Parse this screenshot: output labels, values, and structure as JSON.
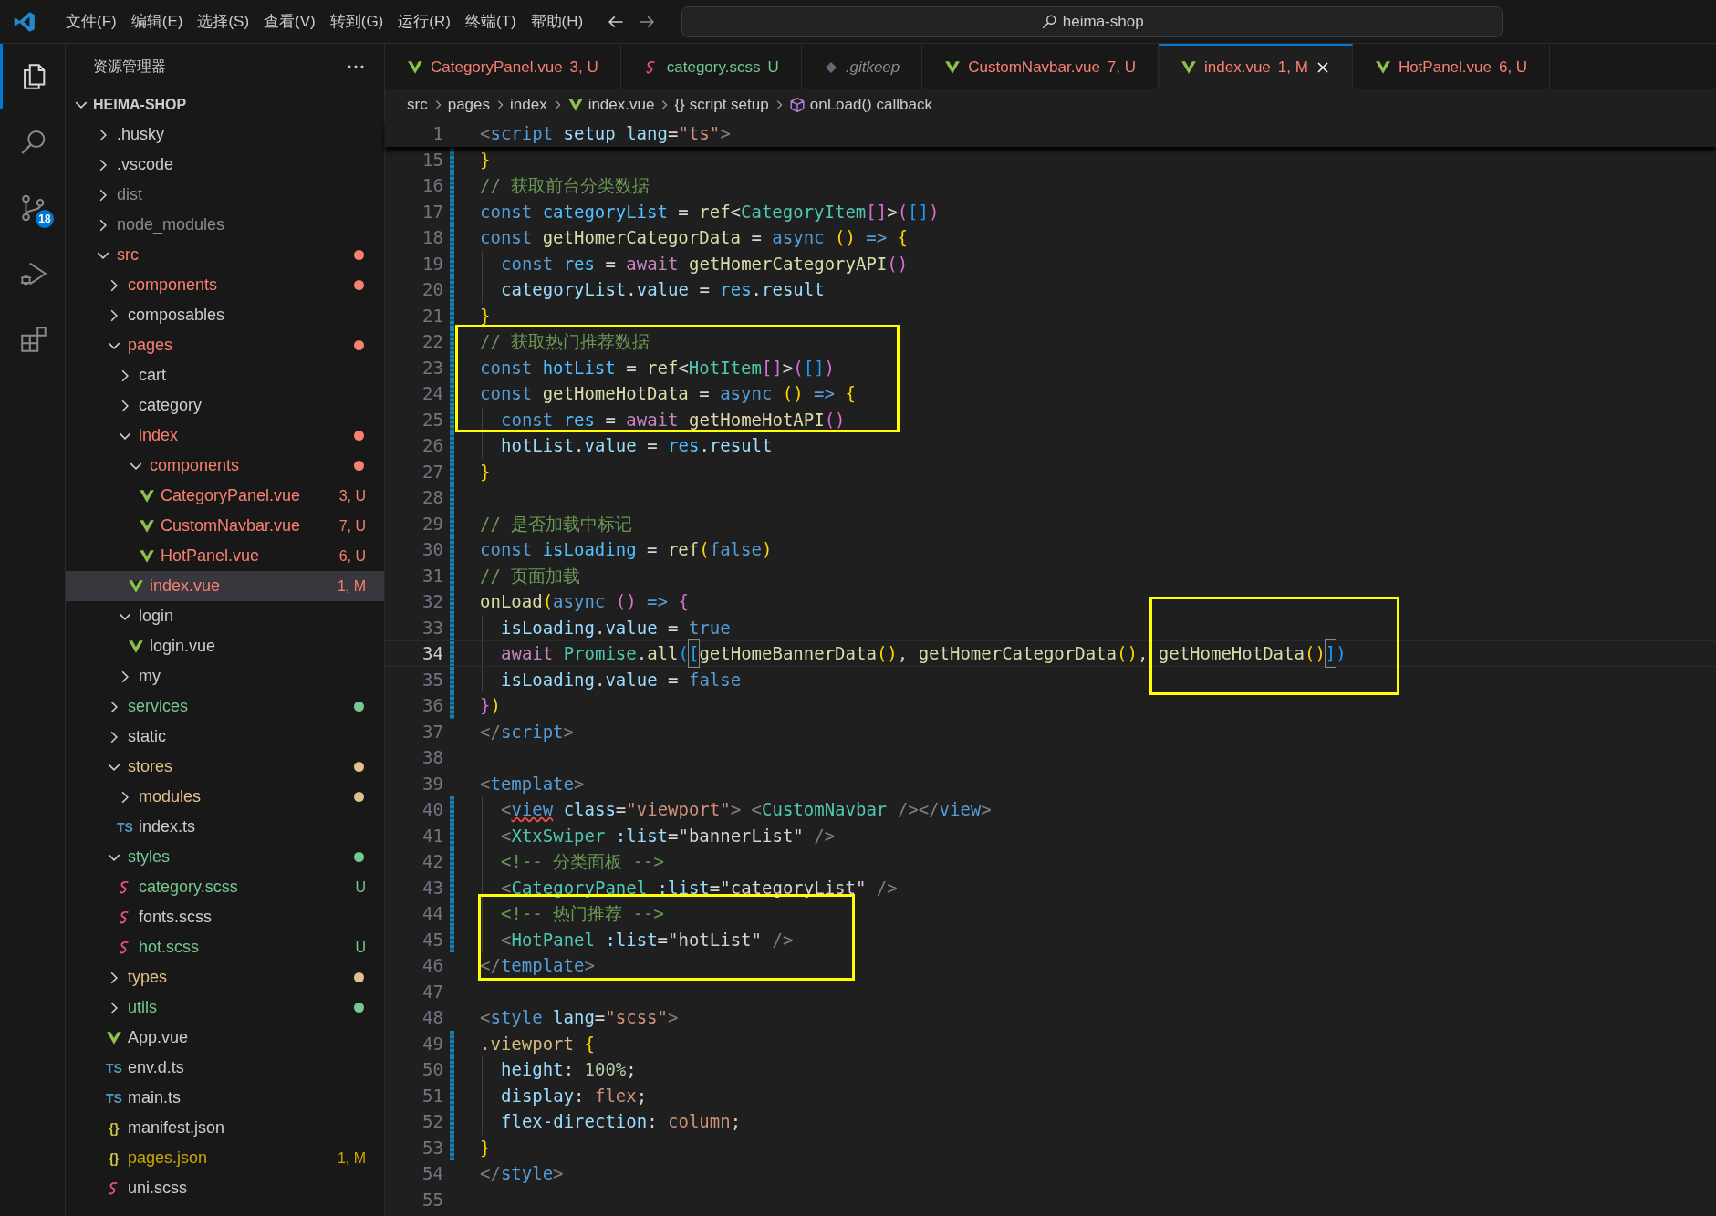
{
  "menu": [
    "文件(F)",
    "编辑(E)",
    "选择(S)",
    "查看(V)",
    "转到(G)",
    "运行(R)",
    "终端(T)",
    "帮助(H)"
  ],
  "command_center": {
    "text": "heima-shop"
  },
  "activity_bar": [
    {
      "kind": "files",
      "selected": true
    },
    {
      "kind": "search",
      "selected": false
    },
    {
      "kind": "source-control",
      "selected": false,
      "badge": "18"
    },
    {
      "kind": "run",
      "selected": false
    },
    {
      "kind": "extensions",
      "selected": false
    }
  ],
  "explorer": {
    "title": "资源管理器",
    "root": {
      "label": "HEIMA-SHOP",
      "expanded": true
    },
    "tree": [
      {
        "label": ".husky",
        "kind": "folder",
        "expanded": false,
        "color": "#cccccc",
        "dot": false,
        "selected": false
      },
      {
        "label": ".vscode",
        "kind": "folder",
        "expanded": false,
        "color": "#cccccc",
        "dot": false,
        "selected": false
      },
      {
        "label": "dist",
        "kind": "folder",
        "expanded": false,
        "color": "#8c8c8c",
        "dot": false,
        "selected": false
      },
      {
        "label": "node_modules",
        "kind": "folder",
        "expanded": false,
        "color": "#8c8c8c",
        "dot": false,
        "selected": false
      },
      {
        "label": "src",
        "kind": "folder",
        "expanded": true,
        "color": "#f88070",
        "dot": true,
        "selected": false,
        "children": [
          {
            "label": "components",
            "kind": "folder",
            "expanded": false,
            "color": "#f88070",
            "dot": true,
            "selected": false
          },
          {
            "label": "composables",
            "kind": "folder",
            "expanded": false,
            "color": "#cccccc",
            "dot": false,
            "selected": false
          },
          {
            "label": "pages",
            "kind": "folder",
            "expanded": true,
            "color": "#f88070",
            "dot": true,
            "selected": false,
            "children": [
              {
                "label": "cart",
                "kind": "folder",
                "expanded": false,
                "color": "#cccccc",
                "dot": false,
                "selected": false
              },
              {
                "label": "category",
                "kind": "folder",
                "expanded": false,
                "color": "#cccccc",
                "dot": false,
                "selected": false
              },
              {
                "label": "index",
                "kind": "folder",
                "expanded": true,
                "color": "#f88070",
                "dot": true,
                "selected": false,
                "children": [
                  {
                    "label": "components",
                    "kind": "folder",
                    "expanded": true,
                    "color": "#f88070",
                    "dot": true,
                    "selected": false,
                    "children": [
                      {
                        "label": "CategoryPanel.vue",
                        "kind": "vue",
                        "color": "#f88070",
                        "badge": "3, U",
                        "dot": false,
                        "selected": false
                      },
                      {
                        "label": "CustomNavbar.vue",
                        "kind": "vue",
                        "color": "#f88070",
                        "badge": "7, U",
                        "dot": false,
                        "selected": false
                      },
                      {
                        "label": "HotPanel.vue",
                        "kind": "vue",
                        "color": "#f88070",
                        "badge": "6, U",
                        "dot": false,
                        "selected": false
                      }
                    ]
                  },
                  {
                    "label": "index.vue",
                    "kind": "vue",
                    "color": "#f88070",
                    "badge": "1, M",
                    "dot": false,
                    "selected": true
                  }
                ]
              },
              {
                "label": "login",
                "kind": "folder",
                "expanded": true,
                "color": "#cccccc",
                "dot": false,
                "selected": false,
                "children": [
                  {
                    "label": "login.vue",
                    "kind": "vue",
                    "color": "#cccccc",
                    "dot": false,
                    "selected": false
                  }
                ]
              },
              {
                "label": "my",
                "kind": "folder",
                "expanded": false,
                "color": "#cccccc",
                "dot": false,
                "selected": false
              }
            ]
          },
          {
            "label": "services",
            "kind": "folder",
            "expanded": false,
            "color": "#73c991",
            "dot": true,
            "selected": false
          },
          {
            "label": "static",
            "kind": "folder",
            "expanded": false,
            "color": "#cccccc",
            "dot": false,
            "selected": false
          },
          {
            "label": "stores",
            "kind": "folder",
            "expanded": true,
            "color": "#e2c08d",
            "dot": true,
            "selected": false,
            "children": [
              {
                "label": "modules",
                "kind": "folder",
                "expanded": false,
                "color": "#e2c08d",
                "dot": true,
                "selected": false
              },
              {
                "label": "index.ts",
                "kind": "ts",
                "glyph": "TS",
                "color": "#cccccc",
                "dot": false,
                "selected": false
              }
            ]
          },
          {
            "label": "styles",
            "kind": "folder",
            "expanded": true,
            "color": "#73c991",
            "dot": true,
            "selected": false,
            "children": [
              {
                "label": "category.scss",
                "kind": "scss",
                "color": "#73c991",
                "badge": "U",
                "dot": false,
                "selected": false
              },
              {
                "label": "fonts.scss",
                "kind": "scss",
                "color": "#cccccc",
                "dot": false,
                "selected": false
              },
              {
                "label": "hot.scss",
                "kind": "scss",
                "color": "#73c991",
                "badge": "U",
                "dot": false,
                "selected": false
              }
            ]
          },
          {
            "label": "types",
            "kind": "folder",
            "expanded": false,
            "color": "#e2c08d",
            "dot": true,
            "selected": false
          },
          {
            "label": "utils",
            "kind": "folder",
            "expanded": false,
            "color": "#73c991",
            "dot": true,
            "selected": false
          },
          {
            "label": "App.vue",
            "kind": "vue",
            "color": "#cccccc",
            "dot": false,
            "selected": false
          },
          {
            "label": "env.d.ts",
            "kind": "ts",
            "glyph": "TS",
            "color": "#cccccc",
            "dot": false,
            "selected": false
          },
          {
            "label": "main.ts",
            "kind": "ts",
            "glyph": "TS",
            "color": "#cccccc",
            "dot": false,
            "selected": false
          },
          {
            "label": "manifest.json",
            "kind": "json",
            "glyph": "{}",
            "color": "#cccccc",
            "dot": false,
            "selected": false
          },
          {
            "label": "pages.json",
            "kind": "json",
            "glyph": "{}",
            "color": "#cca700",
            "badge": "1, M",
            "dot": false,
            "selected": false
          },
          {
            "label": "uni.scss",
            "kind": "scss",
            "color": "#cccccc",
            "dot": false,
            "selected": false
          }
        ]
      }
    ]
  },
  "tabs": [
    {
      "label": "CategoryPanel.vue",
      "badge": "3, U",
      "kind": "vue",
      "color": "#f88070",
      "preview": false,
      "selected": false
    },
    {
      "label": "category.scss",
      "badge": "U",
      "kind": "scss",
      "color": "#73c991",
      "preview": false,
      "selected": false
    },
    {
      "label": ".gitkeep",
      "kind": "file",
      "color": "#8c8c8c",
      "preview": true,
      "selected": false
    },
    {
      "label": "CustomNavbar.vue",
      "badge": "7, U",
      "kind": "vue",
      "color": "#f88070",
      "preview": false,
      "selected": false
    },
    {
      "label": "index.vue",
      "badge": "1, M",
      "kind": "vue",
      "color": "#f88070",
      "preview": false,
      "selected": true
    },
    {
      "label": "HotPanel.vue",
      "badge": "6, U",
      "kind": "vue",
      "color": "#f88070",
      "preview": false,
      "selected": false
    }
  ],
  "breadcrumb": [
    {
      "label": "src",
      "kind": "folder"
    },
    {
      "label": "pages",
      "kind": "folder"
    },
    {
      "label": "index",
      "kind": "folder"
    },
    {
      "label": "index.vue",
      "kind": "vue"
    },
    {
      "label": "script setup",
      "kind": "block",
      "glyph": "{}"
    },
    {
      "label": "onLoad() callback",
      "kind": "method"
    }
  ],
  "editor": {
    "sticky_line": {
      "n": "1",
      "tokens": [
        {
          "kind": "tag",
          "s": "<"
        },
        {
          "kind": "keyword",
          "s": "script"
        },
        {
          "kind": "variable",
          "s": " setup"
        },
        {
          "kind": "variable",
          "s": " lang"
        },
        {
          "kind": "plain",
          "s": "="
        },
        {
          "kind": "string",
          "s": "\"ts\""
        },
        {
          "kind": "tag",
          "s": ">"
        }
      ]
    },
    "lines": [
      {
        "n": "15",
        "changed": true,
        "indented": false,
        "current": false,
        "tokens": [
          {
            "kind": "gold",
            "s": "}"
          }
        ]
      },
      {
        "n": "16",
        "changed": true,
        "indented": false,
        "current": false,
        "tokens": [
          {
            "kind": "comment",
            "s": "// 获取前台分类数据"
          }
        ]
      },
      {
        "n": "17",
        "changed": true,
        "indented": false,
        "current": false,
        "tokens": [
          {
            "kind": "keyword",
            "s": "const "
          },
          {
            "kind": "constant",
            "s": "categoryList"
          },
          {
            "kind": "plain",
            "s": " = "
          },
          {
            "kind": "function",
            "s": "ref"
          },
          {
            "kind": "plain",
            "s": "<"
          },
          {
            "kind": "type",
            "s": "CategoryItem"
          },
          {
            "kind": "pink",
            "s": "[]"
          },
          {
            "kind": "plain",
            "s": ">"
          },
          {
            "kind": "pink",
            "s": "("
          },
          {
            "kind": "blue",
            "s": "[]"
          },
          {
            "kind": "pink",
            "s": ")"
          }
        ]
      },
      {
        "n": "18",
        "changed": true,
        "indented": false,
        "current": false,
        "tokens": [
          {
            "kind": "keyword",
            "s": "const "
          },
          {
            "kind": "function",
            "s": "getHomerCategorData"
          },
          {
            "kind": "plain",
            "s": " = "
          },
          {
            "kind": "keyword",
            "s": "async "
          },
          {
            "kind": "gold",
            "s": "()"
          },
          {
            "kind": "keyword",
            "s": " =>"
          },
          {
            "kind": "gold",
            "s": " {"
          }
        ]
      },
      {
        "n": "19",
        "changed": true,
        "indented": true,
        "current": false,
        "tokens": [
          {
            "kind": "keyword",
            "s": "const "
          },
          {
            "kind": "constant",
            "s": "res"
          },
          {
            "kind": "plain",
            "s": " = "
          },
          {
            "kind": "control",
            "s": "await "
          },
          {
            "kind": "function",
            "s": "getHomerCategoryAPI"
          },
          {
            "kind": "pink",
            "s": "()"
          }
        ]
      },
      {
        "n": "20",
        "changed": true,
        "indented": true,
        "current": false,
        "tokens": [
          {
            "kind": "variable",
            "s": "categoryList"
          },
          {
            "kind": "plain",
            "s": "."
          },
          {
            "kind": "variable",
            "s": "value"
          },
          {
            "kind": "plain",
            "s": " = "
          },
          {
            "kind": "constant",
            "s": "res"
          },
          {
            "kind": "plain",
            "s": "."
          },
          {
            "kind": "variable",
            "s": "result"
          }
        ]
      },
      {
        "n": "21",
        "changed": true,
        "indented": false,
        "current": false,
        "tokens": [
          {
            "kind": "gold",
            "s": "}"
          }
        ]
      },
      {
        "n": "22",
        "changed": true,
        "indented": false,
        "current": false,
        "tokens": [
          {
            "kind": "comment",
            "s": "// 获取热门推荐数据"
          }
        ]
      },
      {
        "n": "23",
        "changed": true,
        "indented": false,
        "current": false,
        "tokens": [
          {
            "kind": "keyword",
            "s": "const "
          },
          {
            "kind": "constant",
            "s": "hotList"
          },
          {
            "kind": "plain",
            "s": " = "
          },
          {
            "kind": "function",
            "s": "ref"
          },
          {
            "kind": "plain",
            "s": "<"
          },
          {
            "kind": "type",
            "s": "HotItem"
          },
          {
            "kind": "pink",
            "s": "[]"
          },
          {
            "kind": "plain",
            "s": ">"
          },
          {
            "kind": "pink",
            "s": "("
          },
          {
            "kind": "blue",
            "s": "[]"
          },
          {
            "kind": "pink",
            "s": ")"
          }
        ]
      },
      {
        "n": "24",
        "changed": true,
        "indented": false,
        "current": false,
        "tokens": [
          {
            "kind": "keyword",
            "s": "const "
          },
          {
            "kind": "function",
            "s": "getHomeHotData"
          },
          {
            "kind": "plain",
            "s": " = "
          },
          {
            "kind": "keyword",
            "s": "async "
          },
          {
            "kind": "gold",
            "s": "()"
          },
          {
            "kind": "keyword",
            "s": " =>"
          },
          {
            "kind": "gold",
            "s": " {"
          }
        ]
      },
      {
        "n": "25",
        "changed": true,
        "indented": true,
        "current": false,
        "tokens": [
          {
            "kind": "keyword",
            "s": "const "
          },
          {
            "kind": "constant",
            "s": "res"
          },
          {
            "kind": "plain",
            "s": " = "
          },
          {
            "kind": "control",
            "s": "await "
          },
          {
            "kind": "function",
            "s": "getHomeHotAPI"
          },
          {
            "kind": "pink",
            "s": "()"
          }
        ]
      },
      {
        "n": "26",
        "changed": true,
        "indented": true,
        "current": false,
        "tokens": [
          {
            "kind": "variable",
            "s": "hotList"
          },
          {
            "kind": "plain",
            "s": "."
          },
          {
            "kind": "variable",
            "s": "value"
          },
          {
            "kind": "plain",
            "s": " = "
          },
          {
            "kind": "constant",
            "s": "res"
          },
          {
            "kind": "plain",
            "s": "."
          },
          {
            "kind": "variable",
            "s": "result"
          }
        ]
      },
      {
        "n": "27",
        "changed": true,
        "indented": false,
        "current": false,
        "tokens": [
          {
            "kind": "gold",
            "s": "}"
          }
        ]
      },
      {
        "n": "28",
        "changed": true,
        "indented": false,
        "current": false
      },
      {
        "n": "29",
        "changed": true,
        "indented": false,
        "current": false,
        "tokens": [
          {
            "kind": "comment",
            "s": "// 是否加载中标记"
          }
        ]
      },
      {
        "n": "30",
        "changed": true,
        "indented": false,
        "current": false,
        "tokens": [
          {
            "kind": "keyword",
            "s": "const "
          },
          {
            "kind": "constant",
            "s": "isLoading"
          },
          {
            "kind": "plain",
            "s": " = "
          },
          {
            "kind": "function",
            "s": "ref"
          },
          {
            "kind": "gold",
            "s": "("
          },
          {
            "kind": "keyword",
            "s": "false"
          },
          {
            "kind": "gold",
            "s": ")"
          }
        ]
      },
      {
        "n": "31",
        "changed": true,
        "indented": false,
        "current": false,
        "tokens": [
          {
            "kind": "comment",
            "s": "// 页面加载"
          }
        ]
      },
      {
        "n": "32",
        "changed": true,
        "indented": false,
        "current": false,
        "tokens": [
          {
            "kind": "function",
            "s": "onLoad"
          },
          {
            "kind": "gold",
            "s": "("
          },
          {
            "kind": "keyword",
            "s": "async "
          },
          {
            "kind": "pink",
            "s": "()"
          },
          {
            "kind": "keyword",
            "s": " =>"
          },
          {
            "kind": "pink",
            "s": " {"
          }
        ]
      },
      {
        "n": "33",
        "changed": true,
        "indented": true,
        "current": false,
        "tokens": [
          {
            "kind": "variable",
            "s": "isLoading"
          },
          {
            "kind": "plain",
            "s": "."
          },
          {
            "kind": "variable",
            "s": "value"
          },
          {
            "kind": "plain",
            "s": " = "
          },
          {
            "kind": "keyword",
            "s": "true"
          }
        ]
      },
      {
        "n": "34",
        "changed": true,
        "indented": true,
        "current": true,
        "tokens": [
          {
            "kind": "control",
            "s": "await "
          },
          {
            "kind": "type",
            "s": "Promise"
          },
          {
            "kind": "plain",
            "s": "."
          },
          {
            "kind": "function",
            "s": "all"
          },
          {
            "kind": "blue",
            "s": "("
          },
          {
            "kind": "match",
            "s": "["
          },
          {
            "kind": "function",
            "s": "getHomeBannerData"
          },
          {
            "kind": "gold",
            "s": "()"
          },
          {
            "kind": "plain",
            "s": ", "
          },
          {
            "kind": "function",
            "s": "getHomerCategorData"
          },
          {
            "kind": "gold",
            "s": "()"
          },
          {
            "kind": "plain",
            "s": ", "
          },
          {
            "kind": "function",
            "s": "getHomeHotData"
          },
          {
            "kind": "gold",
            "s": "()"
          },
          {
            "kind": "match",
            "s": "]"
          },
          {
            "kind": "blue",
            "s": ")"
          }
        ]
      },
      {
        "n": "35",
        "changed": true,
        "indented": true,
        "current": false,
        "tokens": [
          {
            "kind": "variable",
            "s": "isLoading"
          },
          {
            "kind": "plain",
            "s": "."
          },
          {
            "kind": "variable",
            "s": "value"
          },
          {
            "kind": "plain",
            "s": " = "
          },
          {
            "kind": "keyword",
            "s": "false"
          }
        ]
      },
      {
        "n": "36",
        "changed": true,
        "indented": false,
        "current": false,
        "tokens": [
          {
            "kind": "pink",
            "s": "}"
          },
          {
            "kind": "gold",
            "s": ")"
          }
        ]
      },
      {
        "n": "37",
        "changed": false,
        "indented": false,
        "current": false,
        "tokens": [
          {
            "kind": "tag",
            "s": "</"
          },
          {
            "kind": "keyword",
            "s": "script"
          },
          {
            "kind": "tag",
            "s": ">"
          }
        ]
      },
      {
        "n": "38",
        "changed": false,
        "indented": false,
        "current": false
      },
      {
        "n": "39",
        "changed": false,
        "indented": false,
        "current": false,
        "tokens": [
          {
            "kind": "tag",
            "s": "<"
          },
          {
            "kind": "keyword",
            "s": "template"
          },
          {
            "kind": "tag",
            "s": ">"
          }
        ]
      },
      {
        "n": "40",
        "changed": true,
        "indented": true,
        "current": false,
        "tokens": [
          {
            "kind": "tag",
            "s": "<"
          },
          {
            "kind": "error",
            "s": "view"
          },
          {
            "kind": "variable",
            "s": " class"
          },
          {
            "kind": "plain",
            "s": "="
          },
          {
            "kind": "string",
            "s": "\"viewport\""
          },
          {
            "kind": "tag",
            "s": "> <"
          },
          {
            "kind": "type",
            "s": "CustomNavbar"
          },
          {
            "kind": "tag",
            "s": " /></"
          },
          {
            "kind": "keyword",
            "s": "view"
          },
          {
            "kind": "tag",
            "s": ">"
          }
        ]
      },
      {
        "n": "41",
        "changed": true,
        "indented": true,
        "current": false,
        "tokens": [
          {
            "kind": "tag",
            "s": "<"
          },
          {
            "kind": "type",
            "s": "XtxSwiper"
          },
          {
            "kind": "variable",
            "s": " :list"
          },
          {
            "kind": "plain",
            "s": "=\"bannerList\""
          },
          {
            "kind": "tag",
            "s": " />"
          }
        ]
      },
      {
        "n": "42",
        "changed": true,
        "indented": true,
        "current": false,
        "tokens": [
          {
            "kind": "comment",
            "s": "<!-- 分类面板 -->"
          }
        ]
      },
      {
        "n": "43",
        "changed": true,
        "indented": true,
        "current": false,
        "tokens": [
          {
            "kind": "tag",
            "s": "<"
          },
          {
            "kind": "type",
            "s": "CategoryPanel"
          },
          {
            "kind": "variable",
            "s": " :list"
          },
          {
            "kind": "plain",
            "s": "=\"categoryList\""
          },
          {
            "kind": "tag",
            "s": " />"
          }
        ]
      },
      {
        "n": "44",
        "changed": true,
        "indented": true,
        "current": false,
        "tokens": [
          {
            "kind": "comment",
            "s": "<!-- 热门推荐 -->"
          }
        ]
      },
      {
        "n": "45",
        "changed": true,
        "indented": true,
        "current": false,
        "tokens": [
          {
            "kind": "tag",
            "s": "<"
          },
          {
            "kind": "type",
            "s": "HotPanel"
          },
          {
            "kind": "variable",
            "s": " :list"
          },
          {
            "kind": "plain",
            "s": "=\"hotList\""
          },
          {
            "kind": "tag",
            "s": " />"
          }
        ]
      },
      {
        "n": "46",
        "changed": false,
        "indented": false,
        "current": false,
        "tokens": [
          {
            "kind": "tag",
            "s": "</"
          },
          {
            "kind": "keyword",
            "s": "template"
          },
          {
            "kind": "tag",
            "s": ">"
          }
        ]
      },
      {
        "n": "47",
        "changed": false,
        "indented": false,
        "current": false
      },
      {
        "n": "48",
        "changed": false,
        "indented": false,
        "current": false,
        "tokens": [
          {
            "kind": "tag",
            "s": "<"
          },
          {
            "kind": "keyword",
            "s": "style"
          },
          {
            "kind": "variable",
            "s": " lang"
          },
          {
            "kind": "plain",
            "s": "="
          },
          {
            "kind": "string",
            "s": "\"scss\""
          },
          {
            "kind": "tag",
            "s": ">"
          }
        ]
      },
      {
        "n": "49",
        "changed": true,
        "indented": false,
        "current": false,
        "tokens": [
          {
            "kind": "selector",
            "s": ".viewport"
          },
          {
            "kind": "gold",
            "s": " {"
          }
        ]
      },
      {
        "n": "50",
        "changed": true,
        "indented": true,
        "current": false,
        "tokens": [
          {
            "kind": "variable",
            "s": "height"
          },
          {
            "kind": "plain",
            "s": ": "
          },
          {
            "kind": "number",
            "s": "100%"
          },
          {
            "kind": "plain",
            "s": ";"
          }
        ]
      },
      {
        "n": "51",
        "changed": true,
        "indented": true,
        "current": false,
        "tokens": [
          {
            "kind": "variable",
            "s": "display"
          },
          {
            "kind": "plain",
            "s": ": "
          },
          {
            "kind": "string",
            "s": "flex"
          },
          {
            "kind": "plain",
            "s": ";"
          }
        ]
      },
      {
        "n": "52",
        "changed": true,
        "indented": true,
        "current": false,
        "tokens": [
          {
            "kind": "variable",
            "s": "flex-direction"
          },
          {
            "kind": "plain",
            "s": ": "
          },
          {
            "kind": "string",
            "s": "column"
          },
          {
            "kind": "plain",
            "s": ";"
          }
        ]
      },
      {
        "n": "53",
        "changed": true,
        "indented": false,
        "current": false,
        "tokens": [
          {
            "kind": "gold",
            "s": "}"
          }
        ]
      },
      {
        "n": "54",
        "changed": false,
        "indented": false,
        "current": false,
        "tokens": [
          {
            "kind": "tag",
            "s": "</"
          },
          {
            "kind": "keyword",
            "s": "style"
          },
          {
            "kind": "tag",
            "s": ">"
          }
        ]
      },
      {
        "n": "55",
        "changed": false,
        "indented": false,
        "current": false
      }
    ]
  }
}
